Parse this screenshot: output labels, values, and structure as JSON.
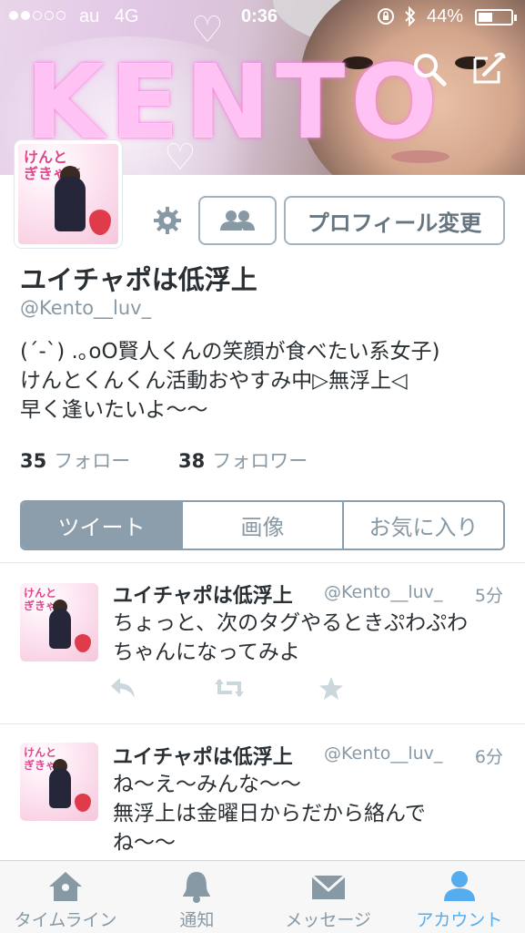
{
  "status_bar": {
    "carrier": "au",
    "network": "4G",
    "time": "0:36",
    "battery_percent": "44%",
    "battery_level": 0.44,
    "signal_bars": 2
  },
  "banner": {
    "text": "KENTO"
  },
  "header_actions": {
    "search_icon": "search-icon",
    "compose_icon": "compose-icon"
  },
  "profile": {
    "avatar_text": "けんと\nぎきゃま",
    "follow_icon": "people-icon",
    "edit_button_label": "プロフィール変更",
    "display_name": "ユイチャポは低浮上",
    "handle": "@Kento__luv_",
    "bio": "(´-`) .｡oO賢人くんの笑顔が食べたい系女子)\nけんとくんくん活動おやすみ中▷無浮上◁\n早く逢いたいよ〜〜",
    "following_count": "35",
    "following_label": "フォロー",
    "followers_count": "38",
    "followers_label": "フォロワー"
  },
  "tabs": [
    {
      "label": "ツイート",
      "active": true
    },
    {
      "label": "画像",
      "active": false
    },
    {
      "label": "お気に入り",
      "active": false
    }
  ],
  "tweets": [
    {
      "name": "ユイチャポは低浮上",
      "handle": "@Kento__luv_",
      "time": "5分",
      "text": "ちょっと、次のタグやるときぷわぷわ\nちゃんになってみよ"
    },
    {
      "name": "ユイチャポは低浮上",
      "handle": "@Kento__luv_",
      "time": "6分",
      "text": "ね〜え〜みんな〜〜\n無浮上は金曜日からだから絡んで\nね〜〜"
    }
  ],
  "tab_bar": [
    {
      "label": "タイムライン",
      "icon": "home-icon",
      "active": false
    },
    {
      "label": "通知",
      "icon": "bell-icon",
      "active": false
    },
    {
      "label": "メッセージ",
      "icon": "envelope-icon",
      "active": false
    },
    {
      "label": "アカウント",
      "icon": "person-icon",
      "active": true
    }
  ],
  "colors": {
    "accent": "#55acee",
    "muted": "#8899a6",
    "segment": "#8c9eac"
  }
}
